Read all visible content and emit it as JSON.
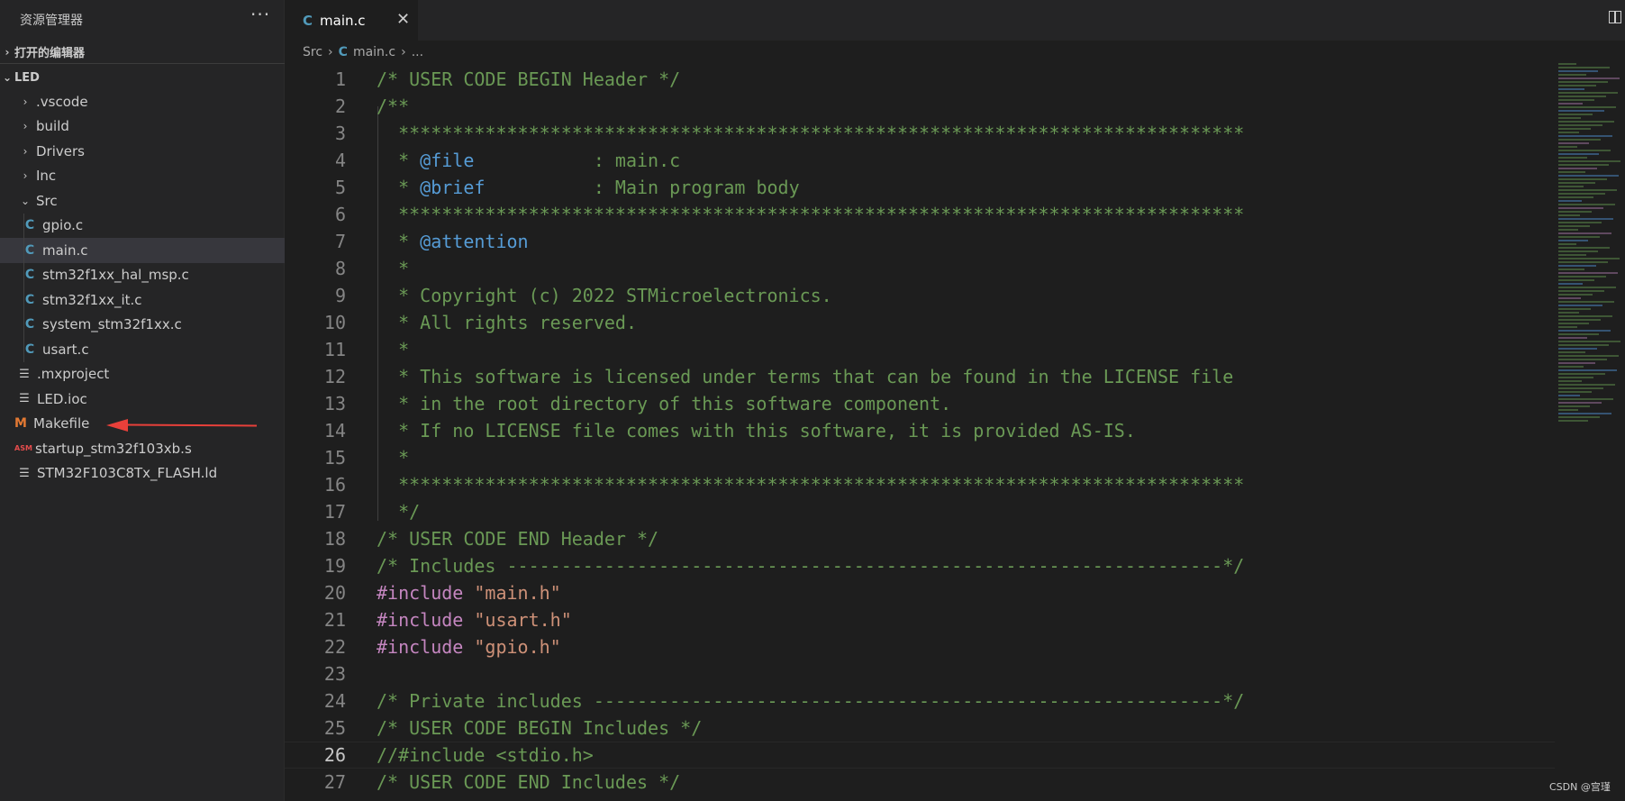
{
  "sidebar": {
    "title": "资源管理器",
    "more": "···",
    "open_editors": "打开的编辑器",
    "project": "LED",
    "items": [
      {
        "label": ".vscode",
        "kind": "folder",
        "expanded": false,
        "icon": "chevron-right-icon"
      },
      {
        "label": "build",
        "kind": "folder",
        "expanded": false,
        "icon": "chevron-right-icon"
      },
      {
        "label": "Drivers",
        "kind": "folder",
        "expanded": false,
        "icon": "chevron-right-icon"
      },
      {
        "label": "Inc",
        "kind": "folder",
        "expanded": false,
        "icon": "chevron-right-icon"
      },
      {
        "label": "Src",
        "kind": "folder",
        "expanded": true,
        "icon": "chevron-down-icon"
      },
      {
        "label": "gpio.c",
        "kind": "c-file",
        "icon": "c-file-icon"
      },
      {
        "label": "main.c",
        "kind": "c-file",
        "icon": "c-file-icon",
        "selected": true
      },
      {
        "label": "stm32f1xx_hal_msp.c",
        "kind": "c-file",
        "icon": "c-file-icon"
      },
      {
        "label": "stm32f1xx_it.c",
        "kind": "c-file",
        "icon": "c-file-icon"
      },
      {
        "label": "system_stm32f1xx.c",
        "kind": "c-file",
        "icon": "c-file-icon"
      },
      {
        "label": "usart.c",
        "kind": "c-file",
        "icon": "c-file-icon"
      },
      {
        "label": ".mxproject",
        "kind": "text-file",
        "icon": "lines-file-icon"
      },
      {
        "label": "LED.ioc",
        "kind": "text-file",
        "icon": "lines-file-icon"
      },
      {
        "label": "Makefile",
        "kind": "makefile",
        "icon": "makefile-icon"
      },
      {
        "label": "startup_stm32f103xb.s",
        "kind": "asm",
        "icon": "asm-file-icon"
      },
      {
        "label": "STM32F103C8Tx_FLASH.ld",
        "kind": "text-file",
        "icon": "lines-file-icon"
      }
    ],
    "glyphs": {
      "c": "C",
      "makefile": "M",
      "asm": "ASM",
      "lines": "☰"
    }
  },
  "tab": {
    "label": "main.c",
    "close": "✕"
  },
  "breadcrumb": {
    "folder": "Src",
    "file": "main.c",
    "more": "..."
  },
  "colors": {
    "comment": "#6a9955",
    "doctag": "#569cd6",
    "keyword": "#c586c0",
    "string": "#ce9178",
    "arrow": "#e8403a"
  },
  "code_lines": [
    {
      "n": "1",
      "parts": [
        [
          "comment",
          "/* USER CODE BEGIN Header */"
        ]
      ]
    },
    {
      "n": "2",
      "parts": [
        [
          "comment",
          "/**"
        ]
      ]
    },
    {
      "n": "3",
      "parts": [
        [
          "comment",
          "  ******************************************************************************"
        ]
      ]
    },
    {
      "n": "4",
      "parts": [
        [
          "comment",
          "  * "
        ],
        [
          "doctag",
          "@file"
        ],
        [
          "comment",
          "           : main.c"
        ]
      ]
    },
    {
      "n": "5",
      "parts": [
        [
          "comment",
          "  * "
        ],
        [
          "doctag",
          "@brief"
        ],
        [
          "comment",
          "          : Main program body"
        ]
      ]
    },
    {
      "n": "6",
      "parts": [
        [
          "comment",
          "  ******************************************************************************"
        ]
      ]
    },
    {
      "n": "7",
      "parts": [
        [
          "comment",
          "  * "
        ],
        [
          "doctag",
          "@attention"
        ]
      ]
    },
    {
      "n": "8",
      "parts": [
        [
          "comment",
          "  *"
        ]
      ]
    },
    {
      "n": "9",
      "parts": [
        [
          "comment",
          "  * Copyright (c) 2022 STMicroelectronics."
        ]
      ]
    },
    {
      "n": "10",
      "parts": [
        [
          "comment",
          "  * All rights reserved."
        ]
      ]
    },
    {
      "n": "11",
      "parts": [
        [
          "comment",
          "  *"
        ]
      ]
    },
    {
      "n": "12",
      "parts": [
        [
          "comment",
          "  * This software is licensed under terms that can be found in the LICENSE file"
        ]
      ]
    },
    {
      "n": "13",
      "parts": [
        [
          "comment",
          "  * in the root directory of this software component."
        ]
      ]
    },
    {
      "n": "14",
      "parts": [
        [
          "comment",
          "  * If no LICENSE file comes with this software, it is provided AS-IS."
        ]
      ]
    },
    {
      "n": "15",
      "parts": [
        [
          "comment",
          "  *"
        ]
      ]
    },
    {
      "n": "16",
      "parts": [
        [
          "comment",
          "  ******************************************************************************"
        ]
      ]
    },
    {
      "n": "17",
      "parts": [
        [
          "comment",
          "  */"
        ]
      ]
    },
    {
      "n": "18",
      "parts": [
        [
          "comment",
          "/* USER CODE END Header */"
        ]
      ]
    },
    {
      "n": "19",
      "parts": [
        [
          "comment",
          "/* Includes ------------------------------------------------------------------*/"
        ]
      ]
    },
    {
      "n": "20",
      "parts": [
        [
          "kw",
          "#include"
        ],
        [
          "plain",
          " "
        ],
        [
          "str",
          "\"main.h\""
        ]
      ]
    },
    {
      "n": "21",
      "parts": [
        [
          "kw",
          "#include"
        ],
        [
          "plain",
          " "
        ],
        [
          "str",
          "\"usart.h\""
        ]
      ]
    },
    {
      "n": "22",
      "parts": [
        [
          "kw",
          "#include"
        ],
        [
          "plain",
          " "
        ],
        [
          "str",
          "\"gpio.h\""
        ]
      ]
    },
    {
      "n": "23",
      "parts": []
    },
    {
      "n": "24",
      "parts": [
        [
          "comment",
          "/* Private includes ----------------------------------------------------------*/"
        ]
      ]
    },
    {
      "n": "25",
      "parts": [
        [
          "comment",
          "/* USER CODE BEGIN Includes */"
        ]
      ]
    },
    {
      "n": "26",
      "parts": [
        [
          "comment",
          "//#include <stdio.h>"
        ]
      ],
      "active": true
    },
    {
      "n": "27",
      "parts": [
        [
          "comment",
          "/* USER CODE END Includes */"
        ]
      ]
    }
  ],
  "watermark": "CSDN @宫瑾"
}
